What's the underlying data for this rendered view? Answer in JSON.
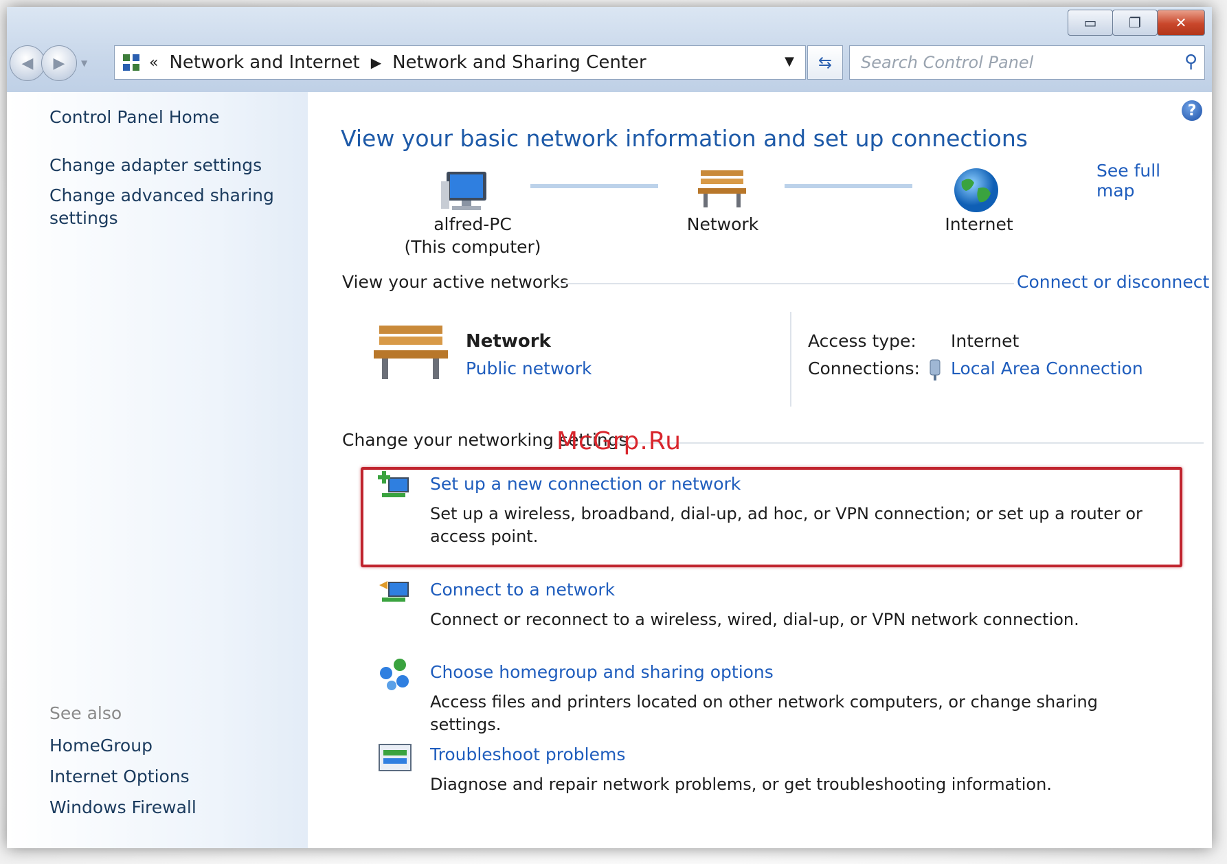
{
  "window": {
    "buttons": {
      "minimize": "▭",
      "restore": "❐",
      "close": "✕"
    }
  },
  "address": {
    "overflow": "«",
    "crumbs": [
      "Network and Internet",
      "Network and Sharing Center"
    ],
    "search_placeholder": "Search Control Panel"
  },
  "sidebar": {
    "home": "Control Panel Home",
    "links": [
      "Change adapter settings",
      "Change advanced sharing settings"
    ],
    "see_also_title": "See also",
    "see_also": [
      "HomeGroup",
      "Internet Options",
      "Windows Firewall"
    ]
  },
  "main": {
    "title": "View your basic network information and set up connections",
    "see_full_map": "See full map",
    "map": {
      "computer_name": "alfred-PC",
      "computer_sub": "(This computer)",
      "network": "Network",
      "internet": "Internet"
    },
    "active_networks_heading": "View your active networks",
    "connect_or_disconnect": "Connect or disconnect",
    "active_network": {
      "name": "Network",
      "type": "Public network",
      "access_type_label": "Access type:",
      "access_type_value": "Internet",
      "connections_label": "Connections:",
      "connections_value": "Local Area Connection"
    },
    "settings_heading": "Change your networking settings",
    "tasks": [
      {
        "title": "Set up a new connection or network",
        "desc": "Set up a wireless, broadband, dial-up, ad hoc, or VPN connection; or set up a router or access point."
      },
      {
        "title": "Connect to a network",
        "desc": "Connect or reconnect to a wireless, wired, dial-up, or VPN network connection."
      },
      {
        "title": "Choose homegroup and sharing options",
        "desc": "Access files and printers located on other network computers, or change sharing settings."
      },
      {
        "title": "Troubleshoot problems",
        "desc": "Diagnose and repair network problems, or get troubleshooting information."
      }
    ]
  },
  "watermark": "McGrp.Ru",
  "colors": {
    "link": "#1f5dbd",
    "title": "#1e5aa8",
    "highlight": "#c0242e"
  }
}
